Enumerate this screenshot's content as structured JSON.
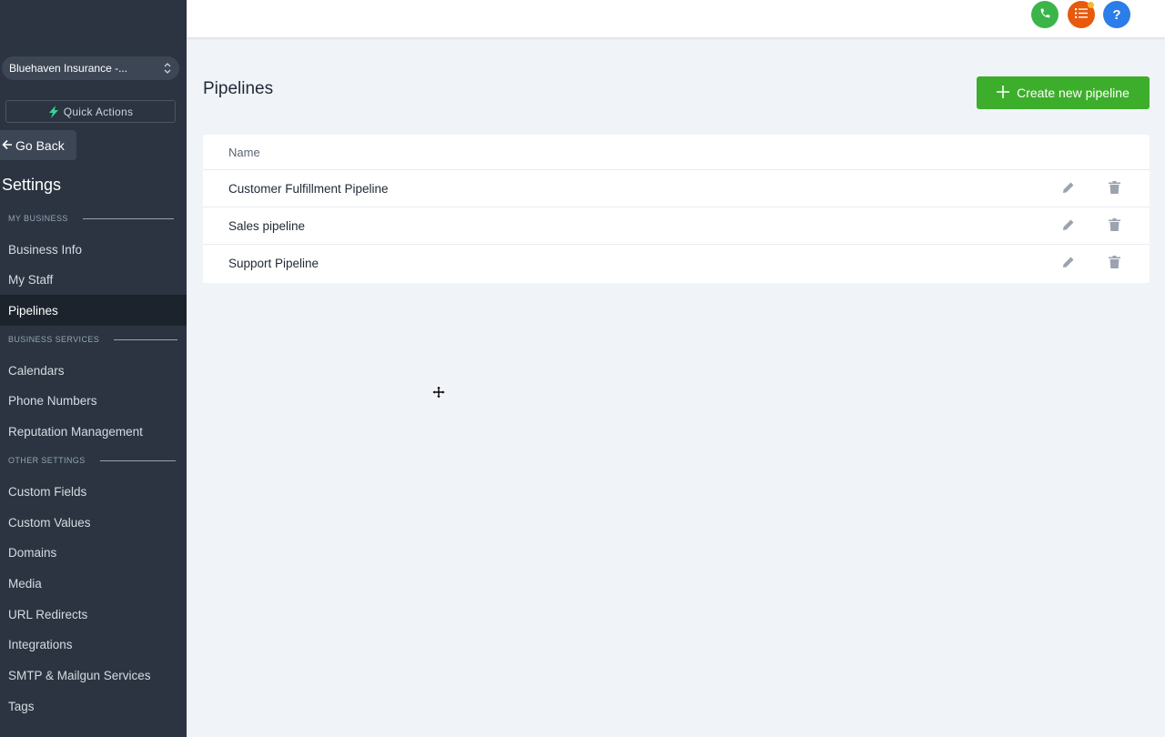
{
  "sidebar": {
    "account": "Bluehaven Insurance -...",
    "quick_actions": "Quick Actions",
    "go_back": "Go Back",
    "settings_title": "Settings",
    "sections": {
      "my_business": "MY BUSINESS",
      "business_services": "BUSINESS SERVICES",
      "other_settings": "OTHER SETTINGS"
    },
    "items": {
      "business_info": "Business Info",
      "my_staff": "My Staff",
      "pipelines": "Pipelines",
      "calendars": "Calendars",
      "phone_numbers": "Phone Numbers",
      "reputation_management": "Reputation Management",
      "custom_fields": "Custom Fields",
      "custom_values": "Custom Values",
      "domains": "Domains",
      "media": "Media",
      "url_redirects": "URL Redirects",
      "integrations": "Integrations",
      "smtp": "SMTP & Mailgun Services",
      "tags": "Tags"
    },
    "active_item": "Pipelines"
  },
  "topbar": {
    "icons": [
      "phone-icon",
      "task-list-icon",
      "help-icon"
    ],
    "help_glyph": "?"
  },
  "main": {
    "title": "Pipelines",
    "create_button": "Create new pipeline",
    "table": {
      "header_name": "Name",
      "rows": [
        "Customer Fulfillment Pipeline",
        "Sales pipeline",
        "Support Pipeline"
      ]
    }
  },
  "colors": {
    "sidebar_bg": "#2b3440",
    "active_item_bg": "#1c232c",
    "primary_green": "#3dae2b",
    "phone_green": "#3bb54a",
    "tasks_orange": "#e8590c",
    "help_blue": "#2b7de9"
  }
}
